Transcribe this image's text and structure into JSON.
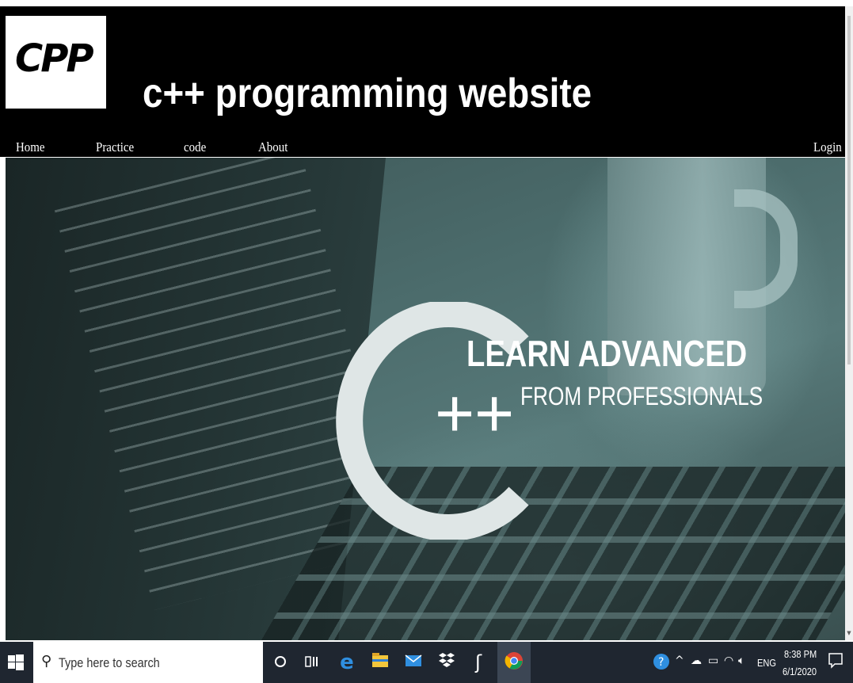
{
  "header": {
    "logo_text": "CPP",
    "title": "c++ programming website"
  },
  "nav": {
    "items": [
      {
        "label": "Home"
      },
      {
        "label": "Practice"
      },
      {
        "label": "code"
      },
      {
        "label": "About"
      }
    ],
    "login": "Login"
  },
  "banner": {
    "headline": "LEARN ADVANCED",
    "subline": "FROM PROFESSIONALS",
    "plus_sign": "+"
  },
  "taskbar": {
    "search_placeholder": "Type here to search",
    "icons": [
      "cortana-icon",
      "task-view-icon",
      "edge-icon",
      "file-explorer-icon",
      "mail-icon",
      "dropbox-icon",
      "app-icon",
      "chrome-icon"
    ],
    "tray_language": "ENG",
    "time": "8:38 PM",
    "date": "6/1/2020"
  }
}
